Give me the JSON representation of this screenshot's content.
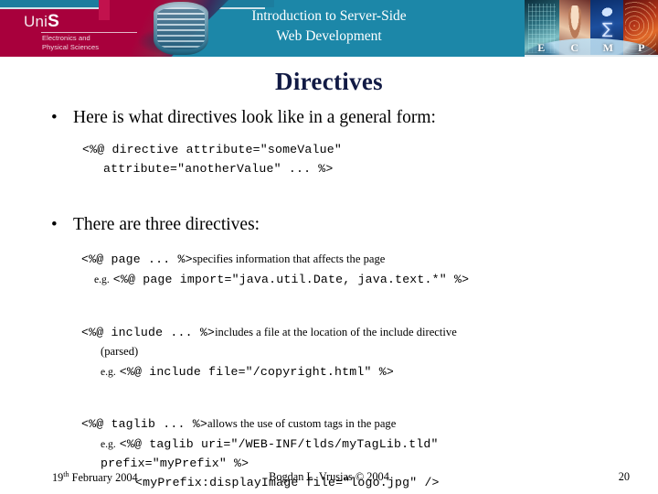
{
  "header": {
    "logo": {
      "uni_prefix": "Uni",
      "uni_suffix": "S",
      "sub_line1": "Electronics and",
      "sub_line2": "Physical Sciences"
    },
    "course_title_line1": "Introduction to Server-Side",
    "course_title_line2": "Web Development",
    "collage_letters": [
      "E",
      "C",
      "M",
      "P"
    ],
    "colors": {
      "teal": "#1c87a8",
      "maroon": "#a8003c"
    }
  },
  "slide": {
    "title": "Directives",
    "title_color": "#111a44",
    "bullets": [
      {
        "text": "Here is what directives look like in a general form:"
      },
      {
        "text": "There are three directives:"
      }
    ],
    "general_form": {
      "line1": "<%@ directive attribute=\"someValue\"",
      "line2": "attribute=\"anotherValue\" ... %>"
    },
    "directives": [
      {
        "syntax": "<%@ page ... %>",
        "description": "specifies information that affects the page",
        "example_label": "e.g.",
        "example": "<%@ page import=\"java.util.Date, java.text.*\" %>"
      },
      {
        "syntax": "<%@ include ... %>",
        "description": "includes a file at the location of the include directive",
        "note": "(parsed)",
        "example_label": "e.g.",
        "example": "<%@ include file=\"/copyright.html\" %>"
      },
      {
        "syntax": "<%@ taglib ... %>",
        "description": "allows the use of custom tags in the page",
        "example_label": "e.g.",
        "example_line1": "<%@ taglib uri=\"/WEB-INF/tlds/myTagLib.tld\"",
        "example_line2": "prefix=\"myPrefix\" %>",
        "example_line3": "<myPrefix:displayImage file=\"logo.jpg\" />"
      }
    ]
  },
  "footer": {
    "date_day": "19",
    "date_ordinal": "th",
    "date_rest": " February 2004",
    "author": "Bogdan L. Vrusias © 2004",
    "page_number": "20"
  }
}
